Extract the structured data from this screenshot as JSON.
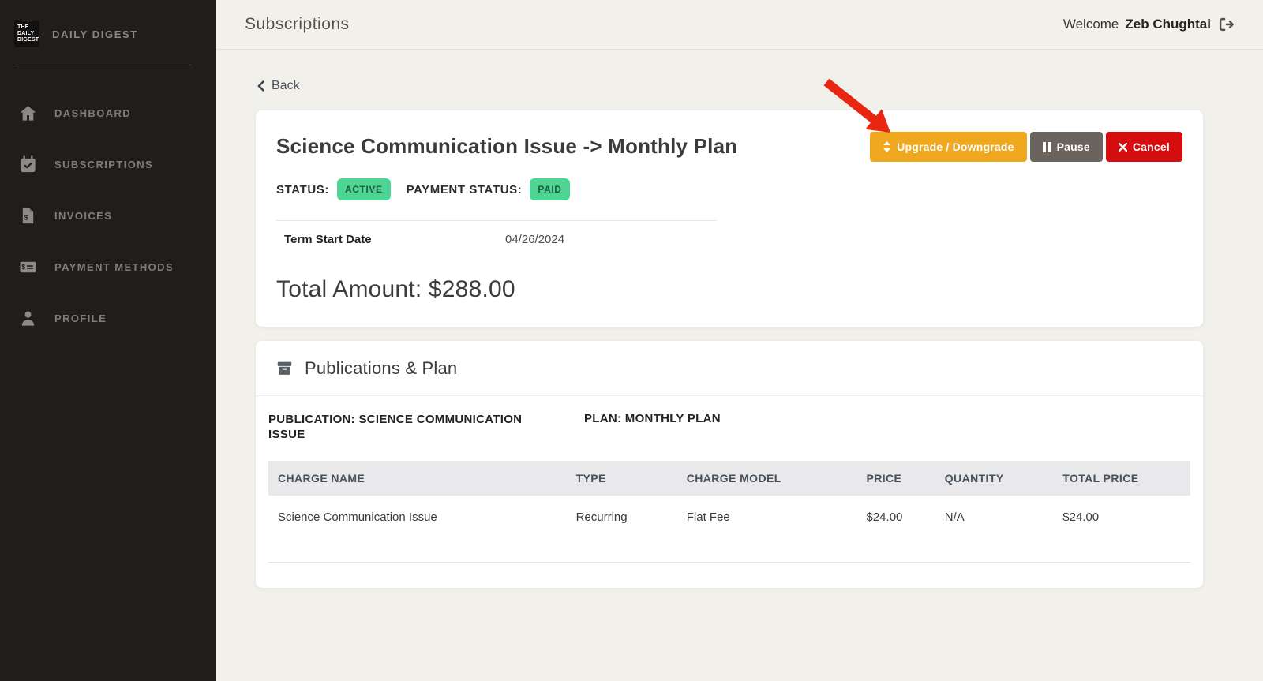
{
  "colors": {
    "sidebar_bg": "#201d1b",
    "page_bg": "#f2f0eb",
    "upgrade_button": "#f0a821",
    "pause_button": "#6b645e",
    "cancel_button": "#d60d0e",
    "badge_bg": "#4fd593",
    "badge_text": "#1b5e41",
    "annotation_arrow": "#e82612"
  },
  "sidebar": {
    "logo": {
      "line1": "THE",
      "line2": "DAILY",
      "line3": "DIGEST"
    },
    "brand": "DAILY DIGEST",
    "items": [
      {
        "label": "DASHBOARD",
        "icon": "home-icon"
      },
      {
        "label": "SUBSCRIPTIONS",
        "icon": "calendar-check-icon"
      },
      {
        "label": "INVOICES",
        "icon": "invoice-icon"
      },
      {
        "label": "PAYMENT METHODS",
        "icon": "payment-card-icon"
      },
      {
        "label": "PROFILE",
        "icon": "user-icon"
      }
    ]
  },
  "header": {
    "title": "Subscriptions",
    "welcome_prefix": "Welcome",
    "user_name": "Zeb Chughtai"
  },
  "content": {
    "back_label": "Back"
  },
  "subscription_card": {
    "title": "Science Communication Issue -> Monthly Plan",
    "upgrade_button": "Upgrade / Downgrade",
    "pause_button": "Pause",
    "cancel_button": "Cancel",
    "status_label": "STATUS:",
    "status_value": "ACTIVE",
    "payment_status_label": "PAYMENT STATUS:",
    "payment_status_value": "PAID",
    "term_start_label": "Term Start Date",
    "term_start_value": "04/26/2024",
    "total_amount": "Total Amount: $288.00"
  },
  "publications_card": {
    "title": "Publications & Plan",
    "publication_label": "PUBLICATION: SCIENCE COMMUNICATION ISSUE",
    "plan_label": "PLAN: MONTHLY PLAN",
    "table": {
      "headers": [
        "CHARGE NAME",
        "TYPE",
        "CHARGE MODEL",
        "PRICE",
        "QUANTITY",
        "TOTAL PRICE"
      ],
      "rows": [
        [
          "Science Communication Issue",
          "Recurring",
          "Flat Fee",
          "$24.00",
          "N/A",
          "$24.00"
        ]
      ]
    }
  }
}
